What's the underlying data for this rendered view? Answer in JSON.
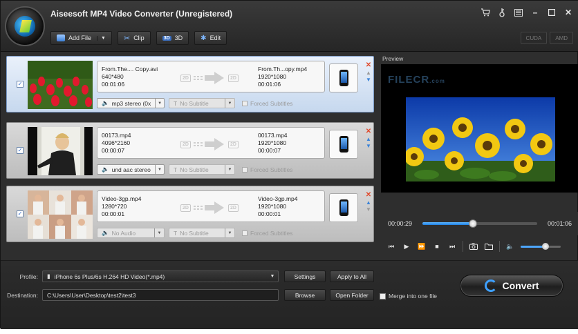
{
  "app": {
    "title": "Aiseesoft MP4 Video Converter (Unregistered)"
  },
  "toolbar": {
    "add_file": "Add File",
    "clip": "Clip",
    "three_d": "3D",
    "edit": "Edit",
    "three_d_badge": "3D"
  },
  "accel": {
    "cuda": "CUDA",
    "amd": "AMD"
  },
  "files": [
    {
      "src_name": "From.The.... Copy.avi",
      "src_res": "640*480",
      "src_dur": "00:01:06",
      "dst_name": "From.Th...opy.mp4",
      "dst_res": "1920*1080",
      "dst_dur": "00:01:06",
      "audio": "mp3 stereo (0x",
      "subtitle": "No Subtitle",
      "forced": "Forced Subtitles",
      "checked": true,
      "selected": true
    },
    {
      "src_name": "00173.mp4",
      "src_res": "4096*2160",
      "src_dur": "00:00:07",
      "dst_name": "00173.mp4",
      "dst_res": "1920*1080",
      "dst_dur": "00:00:07",
      "audio": "und aac stereo",
      "subtitle": "No Subtitle",
      "forced": "Forced Subtitles",
      "checked": true,
      "selected": false
    },
    {
      "src_name": "Video-3gp.mp4",
      "src_res": "1280*720",
      "src_dur": "00:00:01",
      "dst_name": "Video-3gp.mp4",
      "dst_res": "1920*1080",
      "dst_dur": "00:00:01",
      "audio": "No Audio",
      "subtitle": "No Subtitle",
      "forced": "Forced Subtitles",
      "checked": true,
      "selected": false
    }
  ],
  "badge_2d": "2D",
  "preview": {
    "label": "Preview",
    "watermark": "FILECR",
    "watermark_sub": ".com",
    "current_time": "00:00:29",
    "total_time": "00:01:06",
    "progress": 0.44,
    "volume": 0.62
  },
  "bottom": {
    "profile_label": "Profile:",
    "profile_value": "iPhone 6s Plus/6s H.264 HD Video(*.mp4)",
    "settings": "Settings",
    "apply_all": "Apply to All",
    "destination_label": "Destination:",
    "destination_value": "C:\\Users\\User\\Desktop\\test2\\test3",
    "browse": "Browse",
    "open_folder": "Open Folder",
    "merge": "Merge into one file",
    "convert": "Convert"
  },
  "colors": {
    "accent": "#2f8fe8",
    "selected_row": "#c6d8ee",
    "convert_ring": "#3ea0ff"
  }
}
